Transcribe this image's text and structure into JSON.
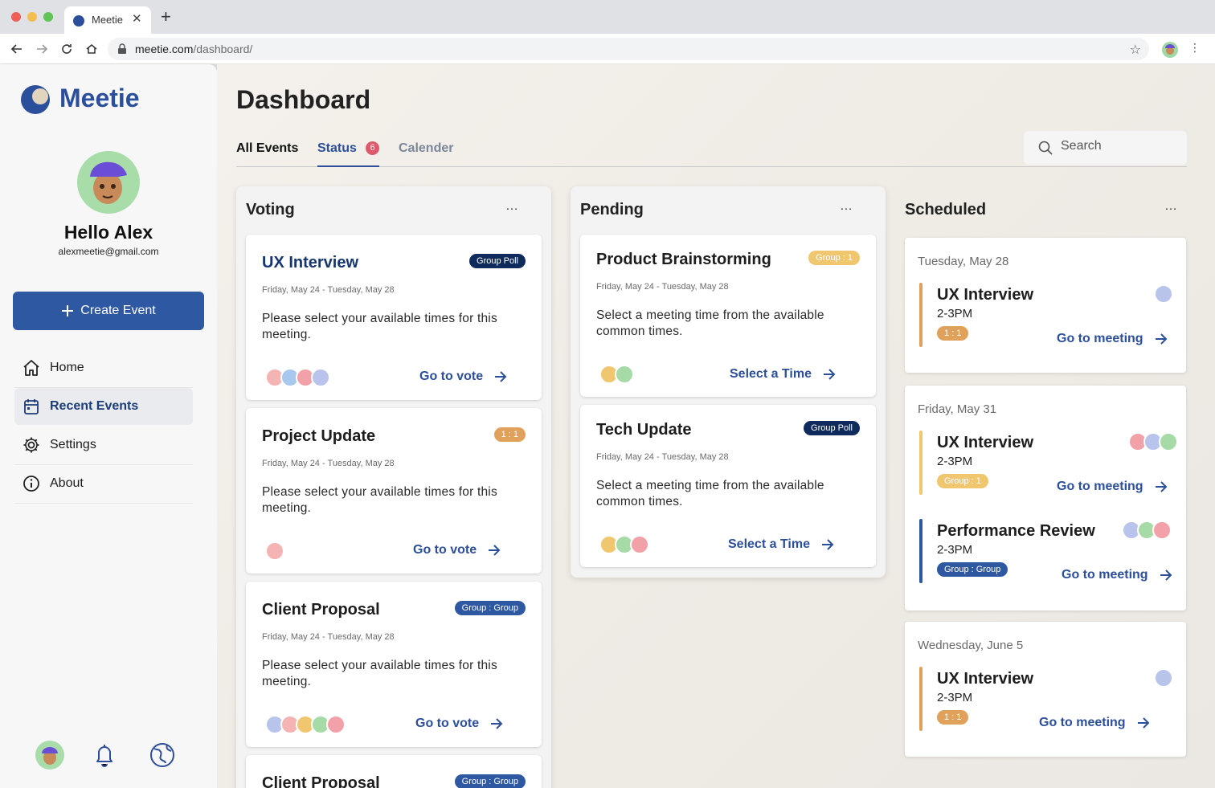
{
  "browser": {
    "tab_title": "Meetie",
    "url_host": "meetie.com",
    "url_path": "/dashboard/"
  },
  "sidebar": {
    "brand": "Meetie",
    "greeting": "Hello Alex",
    "email": "alexmeetie@gmail.com",
    "create_label": "Create Event",
    "nav": [
      {
        "label": "Home",
        "icon": "home-icon"
      },
      {
        "label": "Recent Events",
        "icon": "calendar-icon"
      },
      {
        "label": "Settings",
        "icon": "gear-icon"
      },
      {
        "label": "About",
        "icon": "info-icon"
      }
    ],
    "footer_icons": [
      "avatar",
      "bell-icon",
      "globe-icon"
    ]
  },
  "main": {
    "title": "Dashboard",
    "tabs": [
      {
        "label": "All Events"
      },
      {
        "label": "Status",
        "badge": "6"
      },
      {
        "label": "Calender"
      }
    ],
    "search_placeholder": "Search",
    "more": "…"
  },
  "voting": {
    "title": "Voting",
    "cards": [
      {
        "title": "UX Interview",
        "tag": "Group Poll",
        "date": "Friday, May 24 - Tuesday, May 28",
        "desc": "Please select your available times for this meeting.",
        "action": "Go to vote"
      },
      {
        "title": "Project Update",
        "tag": "1 : 1",
        "date": "Friday, May 24 - Tuesday, May 28",
        "desc": "Please select your available times for this meeting.",
        "action": "Go to vote"
      },
      {
        "title": "Client Proposal",
        "tag": "Group : Group",
        "date": "Friday, May 24 - Tuesday, May 28",
        "desc": "Please select your available times for this meeting.",
        "action": "Go to vote"
      },
      {
        "title": "Client Proposal",
        "tag": "Group : Group"
      }
    ]
  },
  "pending": {
    "title": "Pending",
    "cards": [
      {
        "title": "Product Brainstorming",
        "tag": "Group : 1",
        "date": "Friday, May 24 - Tuesday, May 28",
        "desc": "Select a meeting time from the available common times.",
        "action": "Select a Time"
      },
      {
        "title": "Tech Update",
        "tag": "Group Poll",
        "date": "Friday, May 24 - Tuesday, May 28",
        "desc": "Select a meeting time from the available common times.",
        "action": "Select a Time"
      }
    ]
  },
  "scheduled": {
    "title": "Scheduled",
    "days": [
      {
        "date": "Tuesday, May 28",
        "events": [
          {
            "title": "UX Interview",
            "time": "2-3PM",
            "tag": "1 : 1",
            "action": "Go to meeting"
          }
        ]
      },
      {
        "date": "Friday, May 31",
        "events": [
          {
            "title": "UX Interview",
            "time": "2-3PM",
            "tag": "Group : 1",
            "action": "Go to meeting"
          },
          {
            "title": "Performance Review",
            "time": "2-3PM",
            "tag": "Group : Group",
            "action": "Go to meeting"
          }
        ]
      },
      {
        "date": "Wednesday, June 5",
        "events": [
          {
            "title": "UX Interview",
            "time": "2-3PM",
            "tag": "1 : 1",
            "action": "Go to meeting"
          }
        ]
      }
    ]
  },
  "colors": {
    "brand": "#2c4f9b",
    "button": "#2f58a3",
    "navy_tag": "#0f2a5c",
    "orange_tag": "#e0a15a",
    "gold_tag": "#f0c66e",
    "badge": "#e0586a"
  }
}
